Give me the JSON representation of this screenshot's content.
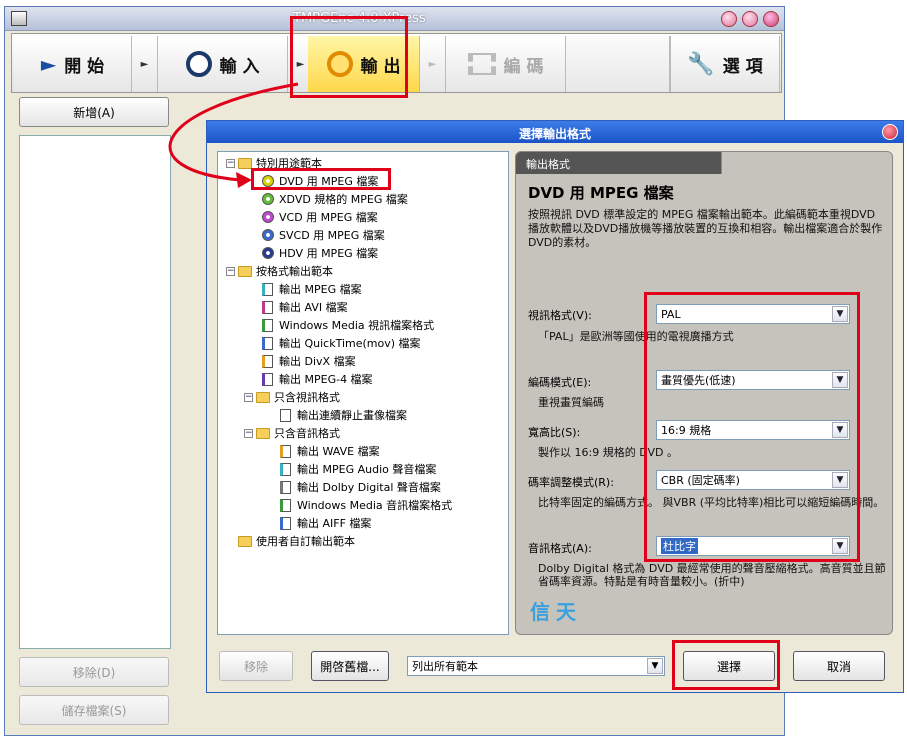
{
  "main_window": {
    "title": "TMPGEnc 4.0 XPress",
    "toolbar": {
      "start": "開 始",
      "input": "輸 入",
      "output": "輸 出",
      "encode": "編 碼",
      "options": "選 項"
    },
    "sidebar": {
      "add": "新增(A)",
      "remove": "移除(D)",
      "save_file": "儲存檔案(S)"
    }
  },
  "dialog": {
    "title": "選擇輸出格式",
    "tree": {
      "special": {
        "label": "特別用途範本",
        "items": [
          "DVD 用 MPEG 檔案",
          "XDVD 規格的 MPEG 檔案",
          "VCD 用 MPEG 檔案",
          "SVCD 用 MPEG 檔案",
          "HDV 用 MPEG 檔案"
        ]
      },
      "by_format": {
        "label": "按格式輸出範本",
        "items": [
          "輸出 MPEG 檔案",
          "輸出 AVI 檔案",
          "Windows Media 視訊檔案格式",
          "輸出 QuickTime(mov) 檔案",
          "輸出 DivX 檔案",
          "輸出 MPEG-4 檔案"
        ]
      },
      "video_only": {
        "label": "只含視訊格式",
        "items": [
          "輸出連續靜止畫像檔案"
        ]
      },
      "audio_only": {
        "label": "只含音訊格式",
        "items": [
          "輸出 WAVE 檔案",
          "輸出 MPEG Audio 聲音檔案",
          "輸出 Dolby Digital 聲音檔案",
          "Windows Media 音訊檔案格式",
          "輸出 AIFF 檔案"
        ]
      },
      "custom": {
        "label": "使用者自訂輸出範本"
      }
    },
    "panel": {
      "header": "輸出格式",
      "title": "DVD 用 MPEG 檔案",
      "description": "按照視訊 DVD 標準設定的 MPEG 檔案輸出範本。此編碼範本重視DVD播放軟體以及DVD播放機等播放裝置的互換和相容。輸出檔案適合於製作DVD的素材。",
      "fields": [
        {
          "label": "視訊格式(V):",
          "value": "PAL",
          "note": "「PAL」是歐洲等國使用的電視廣播方式"
        },
        {
          "label": "編碼模式(E):",
          "value": "畫質優先(低速)",
          "note": "重視畫質編碼"
        },
        {
          "label": "寬高比(S):",
          "value": "16:9 規格",
          "note": "製作以 16:9 規格的 DVD 。"
        },
        {
          "label": "碼率調整模式(R):",
          "value": "CBR (固定碼率)",
          "note": "比特率固定的編碼方式。 與VBR (平均比特率)相比可以縮短編碼時間。"
        },
        {
          "label": "音訊格式(A):",
          "value": "杜比字",
          "note": "Dolby Digital 格式為 DVD 最經常使用的聲音壓縮格式。高音質並且節省碼率資源。特點是有時音量較小。(折中)"
        }
      ],
      "watermark": "信天"
    },
    "buttons": {
      "remove": "移除",
      "open_old": "開啓舊檔...",
      "list_filter": "列出所有範本",
      "select": "選擇",
      "cancel": "取消"
    }
  },
  "colors": {
    "highlight": "#e0001a",
    "dialog_title": "#1b54c7",
    "selection": "#316ac5"
  }
}
